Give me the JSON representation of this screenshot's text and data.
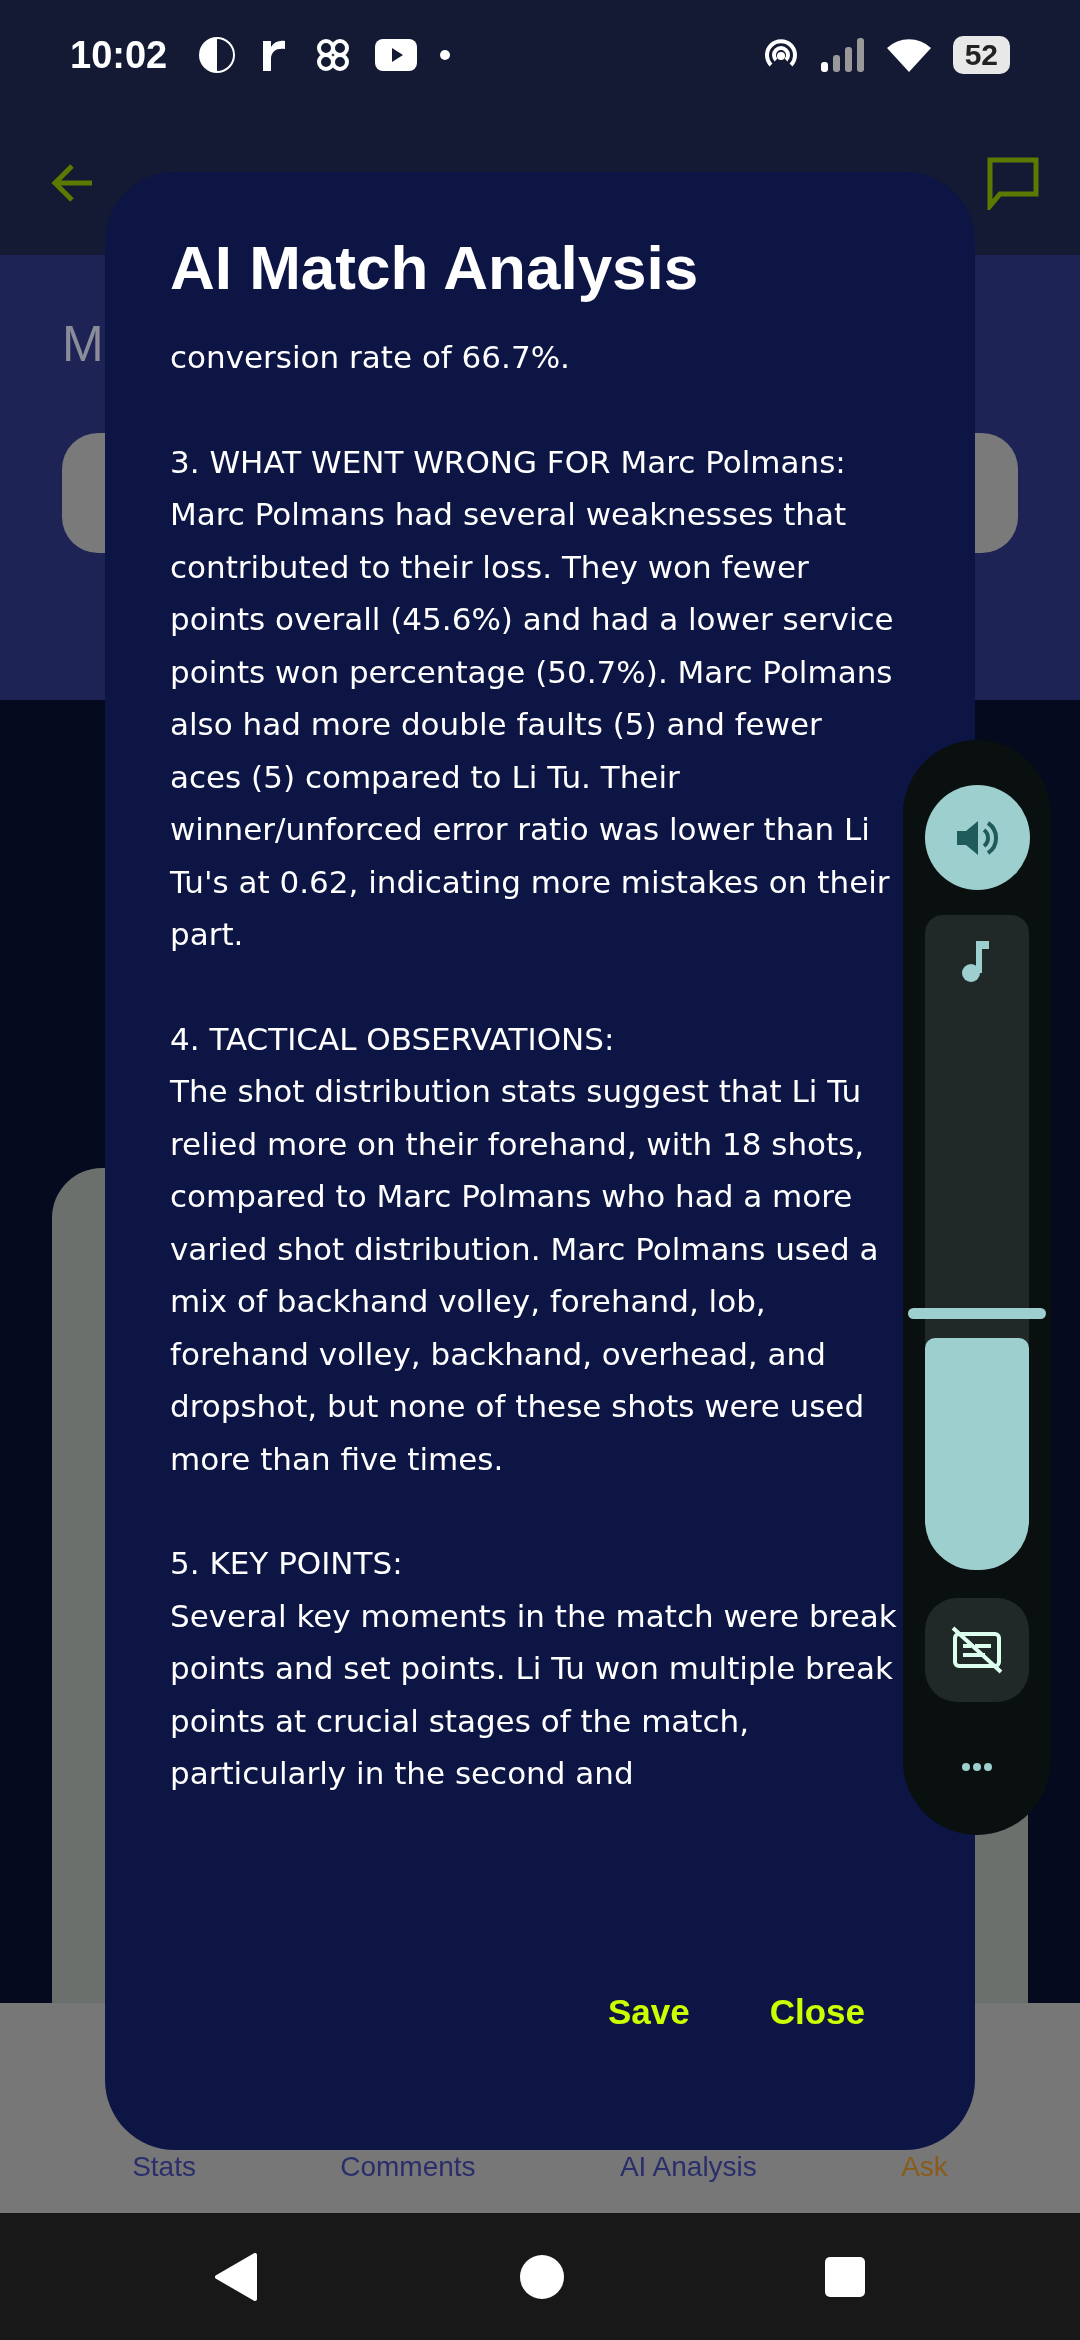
{
  "status_bar": {
    "time": "10:02",
    "battery": "52"
  },
  "header": {
    "title_fragment": "M"
  },
  "bottom_nav": [
    {
      "label": "Stats",
      "highlighted": false
    },
    {
      "label": "Comments",
      "highlighted": false
    },
    {
      "label": "AI Analysis",
      "highlighted": false
    },
    {
      "label": "Ask",
      "highlighted": true
    }
  ],
  "dialog": {
    "title": "AI Match Analysis",
    "sections": [
      {
        "body": "conversion rate of 66.7%."
      },
      {
        "heading": "3. WHAT WENT WRONG FOR Marc Polmans:",
        "body": "Marc Polmans had several weaknesses that contributed to their loss. They won fewer points overall (45.6%) and had a lower service points won percentage (50.7%). Marc Polmans also had more double faults (5) and fewer aces (5) compared to Li Tu. Their winner/unforced error ratio was lower than Li Tu's at 0.62, indicating more mistakes on their part."
      },
      {
        "heading": "4. TACTICAL OBSERVATIONS:",
        "body": "The shot distribution stats suggest that Li Tu relied more on their forehand, with 18 shots, compared to Marc Polmans who had a more varied shot distribution. Marc Polmans used a mix of backhand volley, forehand, lob, forehand volley, backhand, overhead, and dropshot, but none of these shots were used more than five times."
      },
      {
        "heading": "5. KEY POINTS:",
        "body": "Several key moments in the match were break points and set points. Li Tu won multiple break points at crucial stages of the match, particularly in the second and"
      }
    ],
    "buttons": [
      "Save",
      "Close"
    ]
  },
  "volume_panel": {
    "level": 0.4
  }
}
